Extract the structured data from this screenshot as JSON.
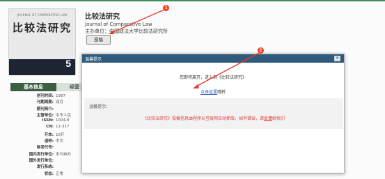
{
  "journal": {
    "cover_en": "JOURNAL OF COMPARATIVE LAW",
    "cover_cn": "比较法研究",
    "cover_issue": "5",
    "title_cn": "比较法研究",
    "title_en": "Journal of Comparative Law",
    "sponsor_label": "主办单位：",
    "sponsor_value": "中国政法大学比较法研究所",
    "submit_label": "投稿"
  },
  "tabs": {
    "basic": "基本信息",
    "other": "经营"
  },
  "info": [
    {
      "label": "创刊时间:",
      "value": "1987"
    },
    {
      "label": "刊期周期:",
      "value": "双月"
    },
    {
      "label": "期刊简介:",
      "value": ""
    },
    {
      "label": "主管单位:",
      "value": "中华人民"
    },
    {
      "label": "ISSN:",
      "value": "1004-8"
    },
    {
      "label": "CN:",
      "value": "11-317"
    },
    {
      "label": "开本:",
      "value": "16开"
    },
    {
      "label": "语种:",
      "value": "中文"
    },
    {
      "label": "邮发代号:",
      "value": ""
    },
    {
      "label": "国内发行单位:",
      "value": "本刊自办"
    },
    {
      "label": "国外发行单位:",
      "value": ""
    },
    {
      "label": "发行系统:",
      "value": ""
    },
    {
      "label": "状态:",
      "value": "正常"
    }
  ],
  "modal": {
    "title": "温馨提示",
    "close_label": "×",
    "message": "您即将离开，进入到《比较法研究》",
    "link_text": "点击这里",
    "jump_suffix": "跳转",
    "notice_title": "温馨提示：",
    "notice_text_a": "《比较法研究》投稿信息由程序从互联网自动抓取，如有错误，请",
    "notice_link": "反馈",
    "notice_text_b": "给我们"
  },
  "annotations": {
    "one": "1",
    "two": "2"
  },
  "colors": {
    "modal_header": "#2f5a7c",
    "tab_active": "#3b5f43",
    "accent_red": "#ff3b1f"
  }
}
